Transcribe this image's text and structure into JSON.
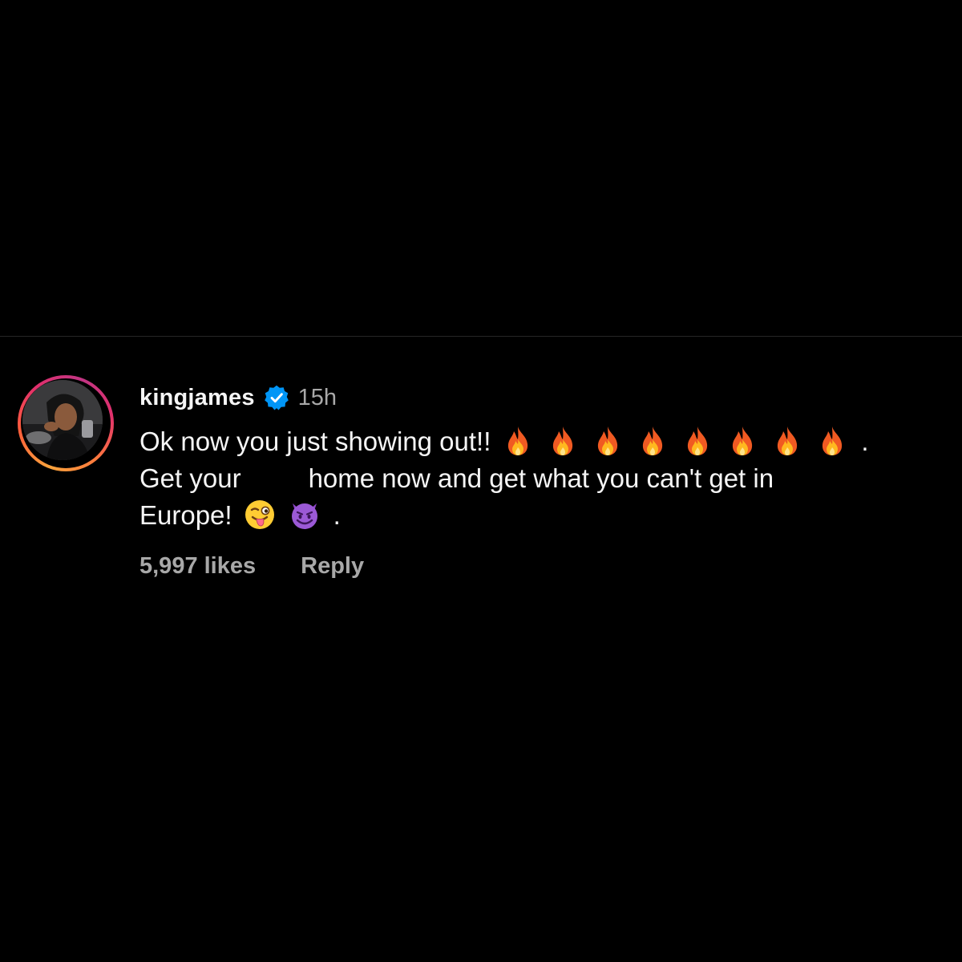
{
  "comment": {
    "username": "kingjames",
    "verified": true,
    "time": "15h",
    "line1": "Ok now you just showing out!!",
    "line1_end": ".",
    "line2_start": "Get your",
    "line2_end": "home now and get what you can't get in",
    "line3": "Europe!",
    "line3_end": ".",
    "likes": "5,997 likes",
    "reply_label": "Reply"
  },
  "icons": {
    "verified": "verified-badge-icon",
    "fire": "fire-emoji",
    "wink": "winking-tongue-emoji",
    "devil": "smiling-devil-emoji"
  },
  "colors": {
    "background": "#000000",
    "text": "#f5f5f5",
    "muted": "#a8a8a8",
    "verified_blue": "#0095f6",
    "divider": "#262626"
  }
}
